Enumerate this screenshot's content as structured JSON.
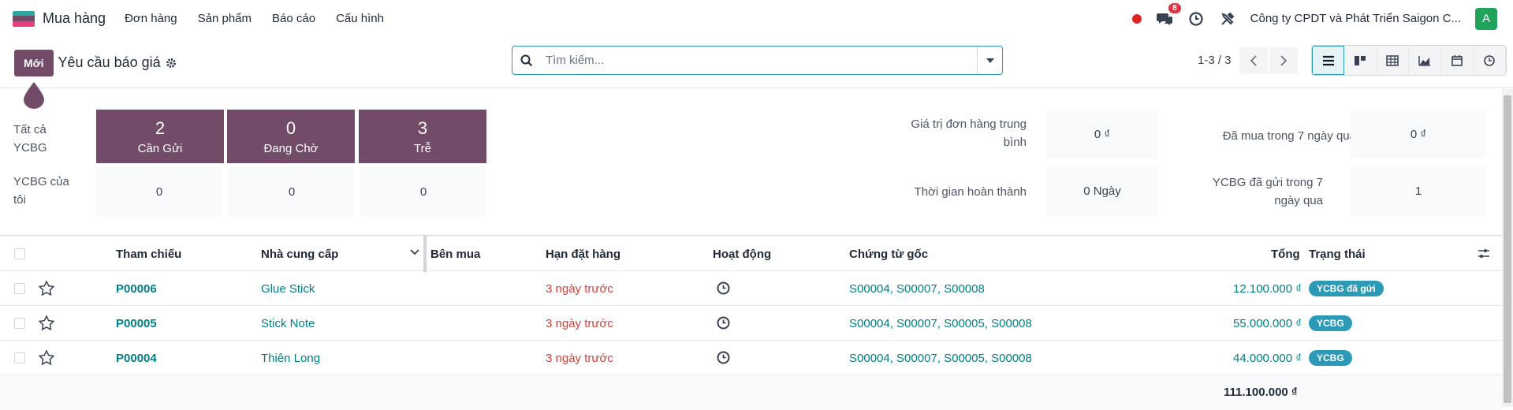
{
  "topbar": {
    "app_name": "Mua hàng",
    "menu": [
      "Đơn hàng",
      "Sản phẩm",
      "Báo cáo",
      "Cấu hình"
    ],
    "messages_badge": "8",
    "company": "Công ty CPDT và Phát Triển Saigon C...",
    "avatar_letter": "A"
  },
  "control": {
    "new_button": "Mới",
    "breadcrumb": "Yêu cầu báo giá",
    "search_placeholder": "Tìm kiếm...",
    "pager": "1-3 / 3"
  },
  "dashboard": {
    "row_labels": [
      "Tất cả YCBG",
      "YCBG của tôi"
    ],
    "tiles_all": [
      {
        "num": "2",
        "label": "Cần Gửi"
      },
      {
        "num": "0",
        "label": "Đang Chờ"
      },
      {
        "num": "3",
        "label": "Trễ"
      }
    ],
    "tiles_mine": [
      "0",
      "0",
      "0"
    ],
    "stats": [
      {
        "label": "Giá trị đơn hàng trung bình",
        "value": "0 ₫"
      },
      {
        "label": "Đã mua trong 7 ngày qua",
        "value": "0 ₫"
      },
      {
        "label": "Thời gian hoàn thành",
        "value": "0 Ngày"
      },
      {
        "label": "YCBG đã gửi trong 7 ngày qua",
        "value": "1"
      }
    ]
  },
  "table": {
    "headers": {
      "ref": "Tham chiếu",
      "vendor": "Nhà cung cấp",
      "buyer": "Bên mua",
      "deadline": "Hạn đặt hàng",
      "activity": "Hoạt động",
      "source": "Chứng từ gốc",
      "total": "Tổng",
      "status": "Trạng thái"
    },
    "rows": [
      {
        "ref": "P00006",
        "vendor": "Glue Stick",
        "deadline": "3 ngày trước",
        "source": "S00004, S00007, S00008",
        "total": "12.100.000 ₫",
        "status": "YCBG đã gửi"
      },
      {
        "ref": "P00005",
        "vendor": "Stick Note",
        "deadline": "3 ngày trước",
        "source": "S00004, S00007, S00005, S00008",
        "total": "55.000.000 ₫",
        "status": "YCBG"
      },
      {
        "ref": "P00004",
        "vendor": "Thiên Long",
        "deadline": "3 ngày trước",
        "source": "S00004, S00007, S00005, S00008",
        "total": "44.000.000 ₫",
        "status": "YCBG"
      }
    ],
    "grand_total": "111.100.000 ₫"
  },
  "colors": {
    "brand": "#714b67",
    "accent": "#2c9ab7",
    "link": "#017e84",
    "danger": "#d23f3a"
  }
}
